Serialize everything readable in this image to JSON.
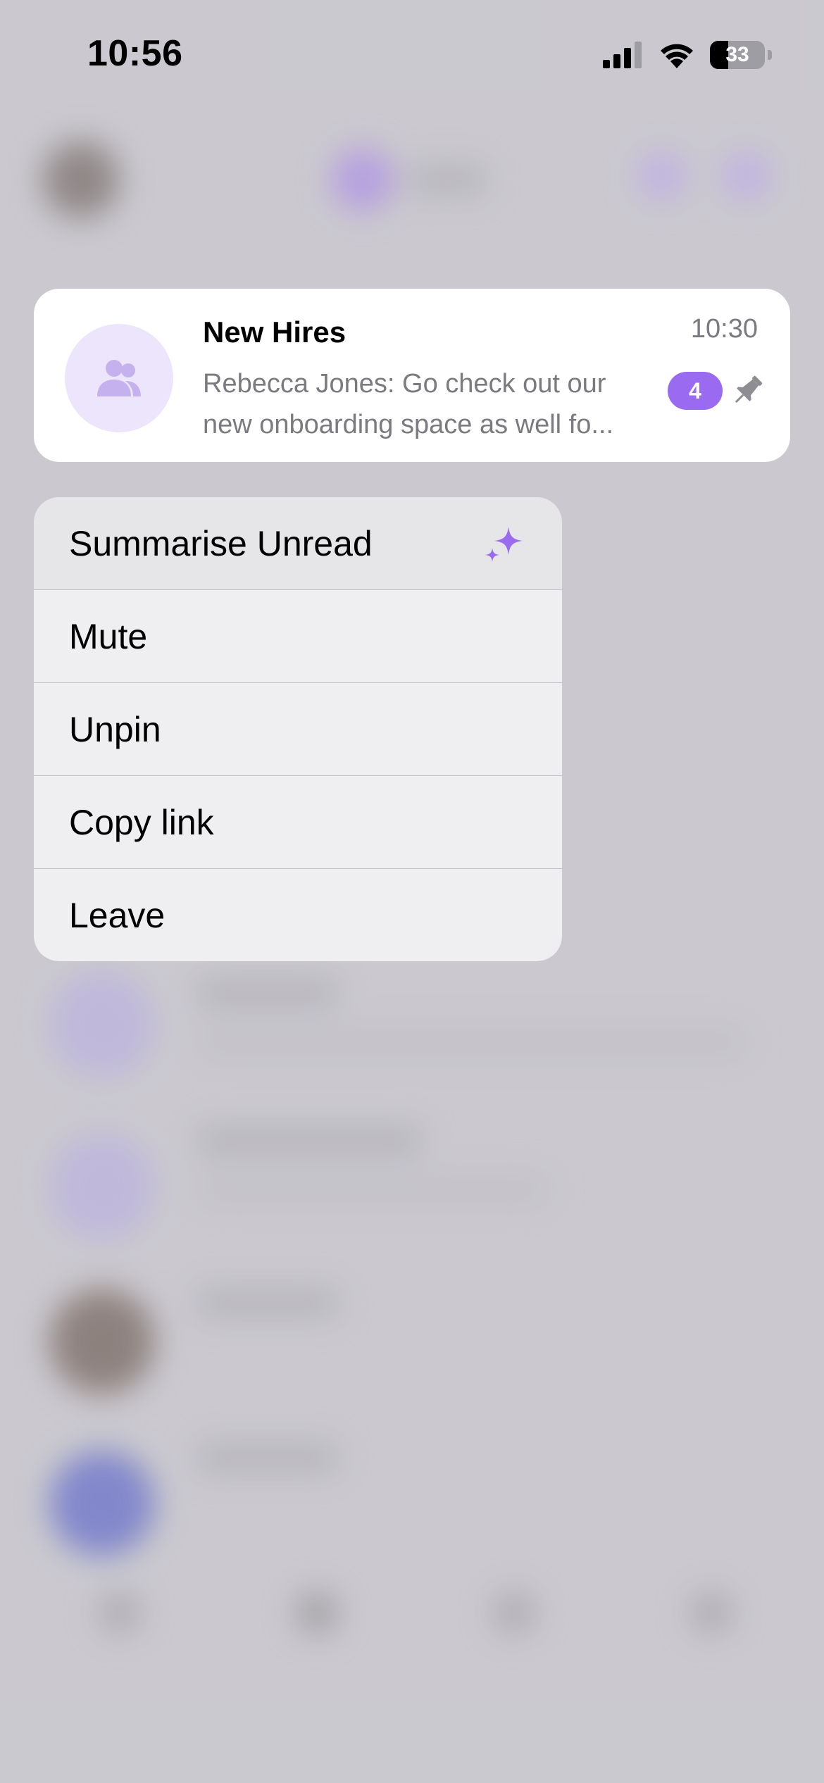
{
  "status_bar": {
    "time": "10:56",
    "battery": "33"
  },
  "chat": {
    "name": "New Hires",
    "preview_line1": "Rebecca Jones: Go check out our",
    "preview_line2": "new onboarding space as well fo...",
    "time": "10:30",
    "unread_count": "4",
    "avatar_icon": "group-icon",
    "pinned_icon": "pin-icon"
  },
  "menu": {
    "items": [
      {
        "label": "Summarise Unread",
        "icon": "sparkle-icon"
      },
      {
        "label": "Mute"
      },
      {
        "label": "Unpin"
      },
      {
        "label": "Copy link"
      },
      {
        "label": "Leave"
      }
    ]
  },
  "colors": {
    "accent": "#9a6bf0",
    "avatar_bg": "#ece5fb",
    "backdrop": "#c9c8ce"
  }
}
